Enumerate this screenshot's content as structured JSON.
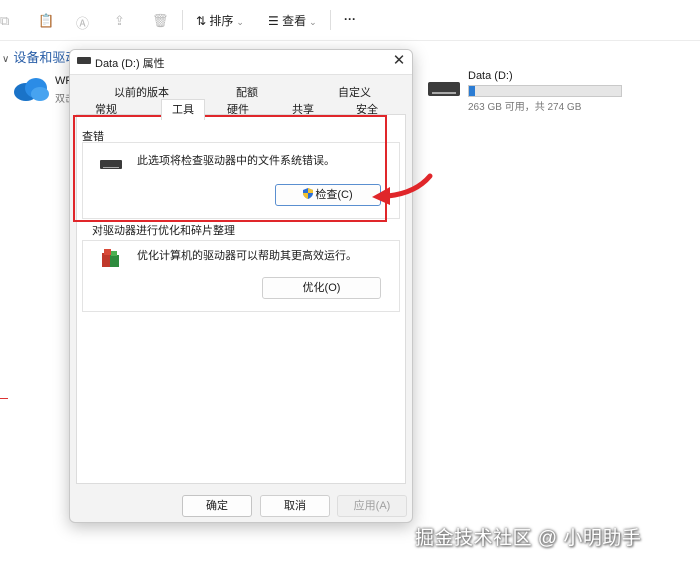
{
  "explorer": {
    "toolbar": {
      "sort_label": "排序",
      "view_label": "查看",
      "more_label": "···"
    },
    "section_header": "设备和驱动",
    "drives": [
      {
        "name": "WP",
        "sub": "双击"
      },
      {
        "name": "Data (D:)",
        "space": "263 GB 可用，共 274 GB",
        "used_fraction": 0.04
      }
    ]
  },
  "dialog": {
    "title": "Data (D:) 属性",
    "close": "✕",
    "tabs_row1": [
      "以前的版本",
      "配额",
      "自定义"
    ],
    "tabs_row2": [
      "常规",
      "工具",
      "硬件",
      "共享",
      "安全"
    ],
    "active_tab": "工具",
    "check": {
      "title": "查错",
      "description": "此选项将检查驱动器中的文件系统错误。",
      "button": "检查(C)"
    },
    "optimize": {
      "title": "对驱动器进行优化和碎片整理",
      "description": "优化计算机的驱动器可以帮助其更高效运行。",
      "button": "优化(O)"
    },
    "buttons": {
      "ok": "确定",
      "cancel": "取消",
      "apply": "应用(A)"
    }
  },
  "watermark": "掘金技术社区 @ 小明助手",
  "colors": {
    "accent": "#2b7cd3",
    "annotation_red": "#e0262a"
  }
}
